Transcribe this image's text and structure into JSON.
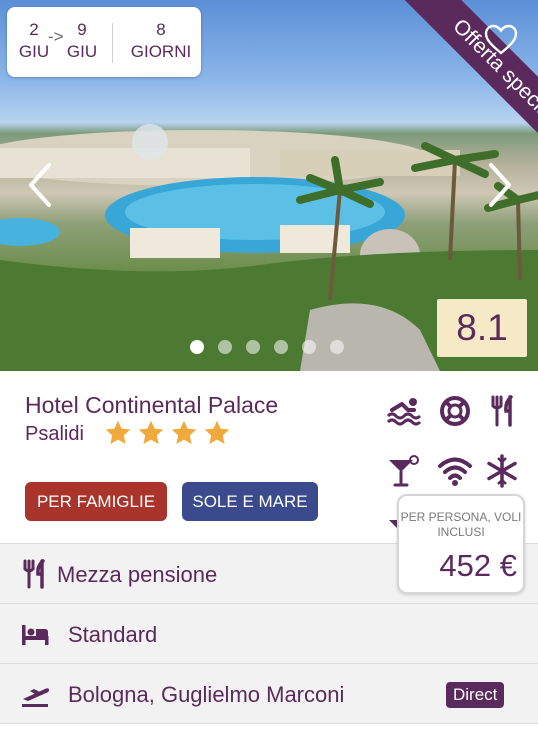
{
  "dates": {
    "start_day": "2",
    "start_month": "GIU",
    "end_day": "9",
    "end_month": "GIU",
    "arrow": "->",
    "duration": "8",
    "duration_unit": "GIORNI"
  },
  "ribbon": {
    "label": "Offerta speciale"
  },
  "gallery": {
    "slides": 6,
    "active": 1
  },
  "rating": {
    "score": "8.1"
  },
  "hotel": {
    "name": "Hotel Continental Palace",
    "location": "Psalidi",
    "stars": 4
  },
  "amenities": [
    "swimmer-icon",
    "lifebuoy-icon",
    "restaurant-icon",
    "bar-icon",
    "wifi-icon",
    "air-conditioning-icon",
    "bar-icon"
  ],
  "tags": {
    "family": "PER FAMIGLIE",
    "sea": "SOLE E MARE"
  },
  "details": {
    "board": "Mezza pensione",
    "room": "Standard",
    "airport": "Bologna, Guglielmo Marconi",
    "flight_badge": "Direct"
  },
  "price": {
    "label": "PER PERSONA, VOLI INCLUSI",
    "value": "452 €"
  },
  "colors": {
    "brand": "#5b2a5d",
    "family_tag": "#a8342c",
    "sea_tag": "#3a4a8c",
    "star": "#f2a93b",
    "score_bg": "#f6e9c6"
  }
}
